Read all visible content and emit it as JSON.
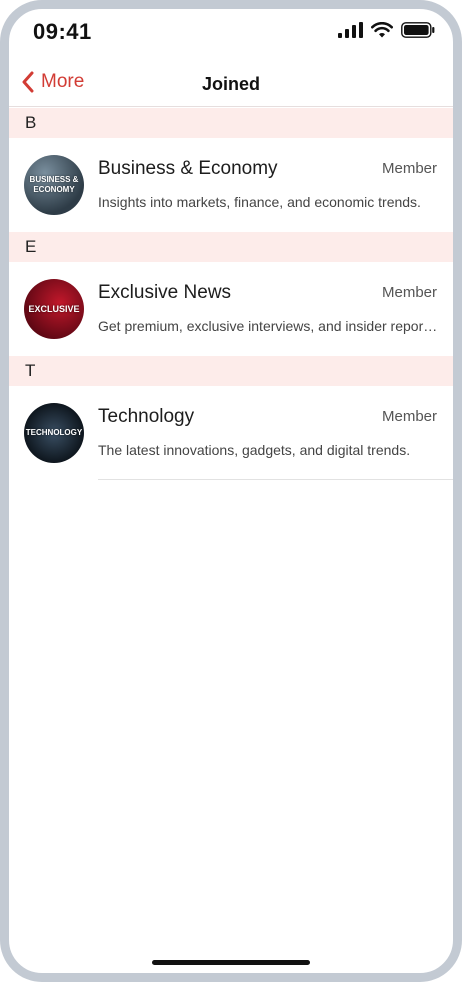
{
  "status_bar": {
    "time": "09:41"
  },
  "nav": {
    "back_label": "More",
    "title": "Joined"
  },
  "sections": [
    {
      "letter": "B",
      "items": [
        {
          "avatar_text": "BUSINESS & ECONOMY",
          "title": "Business & Economy",
          "badge": "Member",
          "description": "Insights into markets, finance, and economic trends."
        }
      ]
    },
    {
      "letter": "E",
      "items": [
        {
          "avatar_text": "EXCLUSIVE",
          "title": "Exclusive News",
          "badge": "Member",
          "description": "Get premium, exclusive interviews, and insider reports…"
        }
      ]
    },
    {
      "letter": "T",
      "items": [
        {
          "avatar_text": "TECHNOLOGY",
          "title": "Technology",
          "badge": "Member",
          "description": "The latest innovations, gadgets, and digital trends."
        }
      ]
    }
  ],
  "colors": {
    "accent": "#d23c35",
    "section_bg": "#fdecea",
    "frame": "#c3cad3"
  },
  "icons": [
    "signal-icon",
    "wifi-icon",
    "battery-icon",
    "chevron-left-icon"
  ]
}
